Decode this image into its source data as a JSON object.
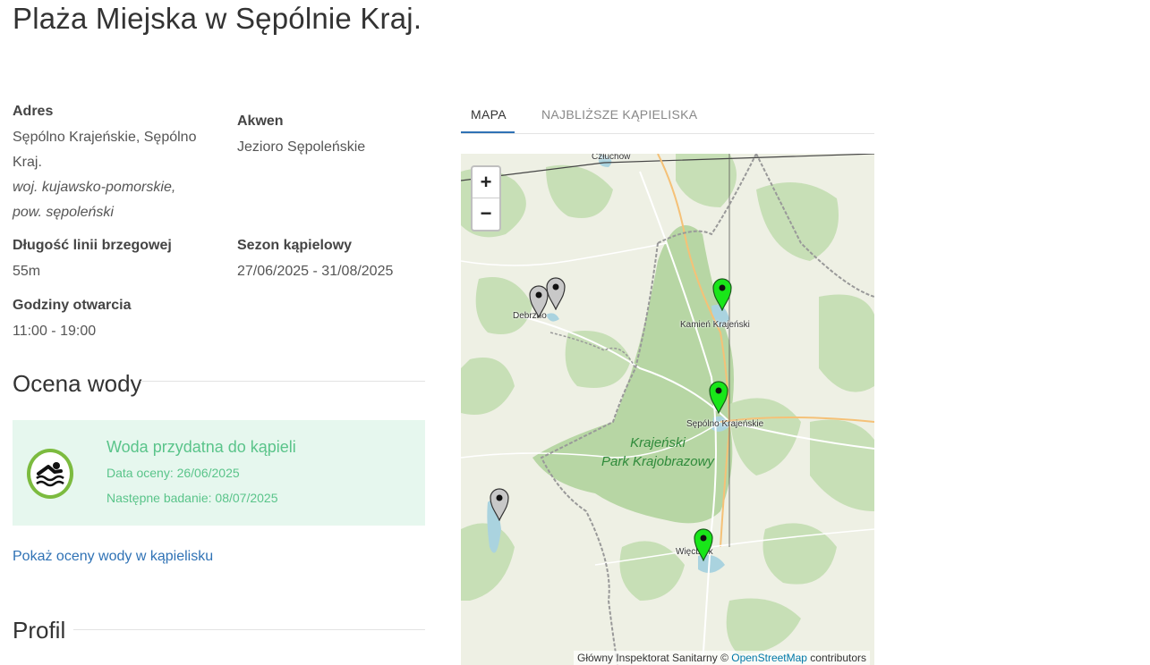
{
  "page": {
    "title": "Plaża Miejska w Sępólnie Kraj."
  },
  "details": {
    "address_label": "Adres",
    "address_line1": "Sępólno Krajeńskie, Sępólno",
    "address_line2": "Kraj.",
    "address_line3": "woj. kujawsko-pomorskie,",
    "address_line4": "pow. sępoleński",
    "waterbody_label": "Akwen",
    "waterbody_value": "Jezioro Sępoleńskie",
    "shoreline_label": "Długość linii brzegowej",
    "shoreline_value": "55m",
    "season_label": "Sezon kąpielowy",
    "season_value": "27/06/2025 - 31/08/2025",
    "hours_label": "Godziny otwarcia",
    "hours_value": "11:00 - 19:00"
  },
  "water_quality": {
    "heading": "Ocena wody",
    "status": "Woda przydatna do kąpieli",
    "assessment_date": "Data oceny: 26/06/2025",
    "next_test": "Następne badanie: 08/07/2025",
    "status_color": "#5ac48a",
    "icon": "swimmer-icon"
  },
  "links": {
    "show_assessments": "Pokaż oceny wody w kąpielisku"
  },
  "profile": {
    "heading": "Profil"
  },
  "tabs": [
    {
      "label": "MAPA",
      "active": true
    },
    {
      "label": "NAJBLIŻSZE KĄPIELISKA",
      "active": false
    }
  ],
  "map": {
    "zoom_in": "+",
    "zoom_out": "−",
    "attribution_prefix": "Główny Inspektorat Sanitarny © ",
    "attribution_link": "OpenStreetMap",
    "attribution_suffix": " contributors",
    "towns": {
      "czluchow": "Człuchów",
      "debrzno": "Debrzno",
      "kamien": "Kamień Krajeński",
      "sepolno": "Sępólno Krajeńskie",
      "wiecbork": "Więcbork"
    },
    "park_line1": "Krajeński",
    "park_line2": "Park Krajobrazowy",
    "marker_colors": {
      "suitable": "#19e619",
      "inactive": "#c8c8c8"
    }
  }
}
